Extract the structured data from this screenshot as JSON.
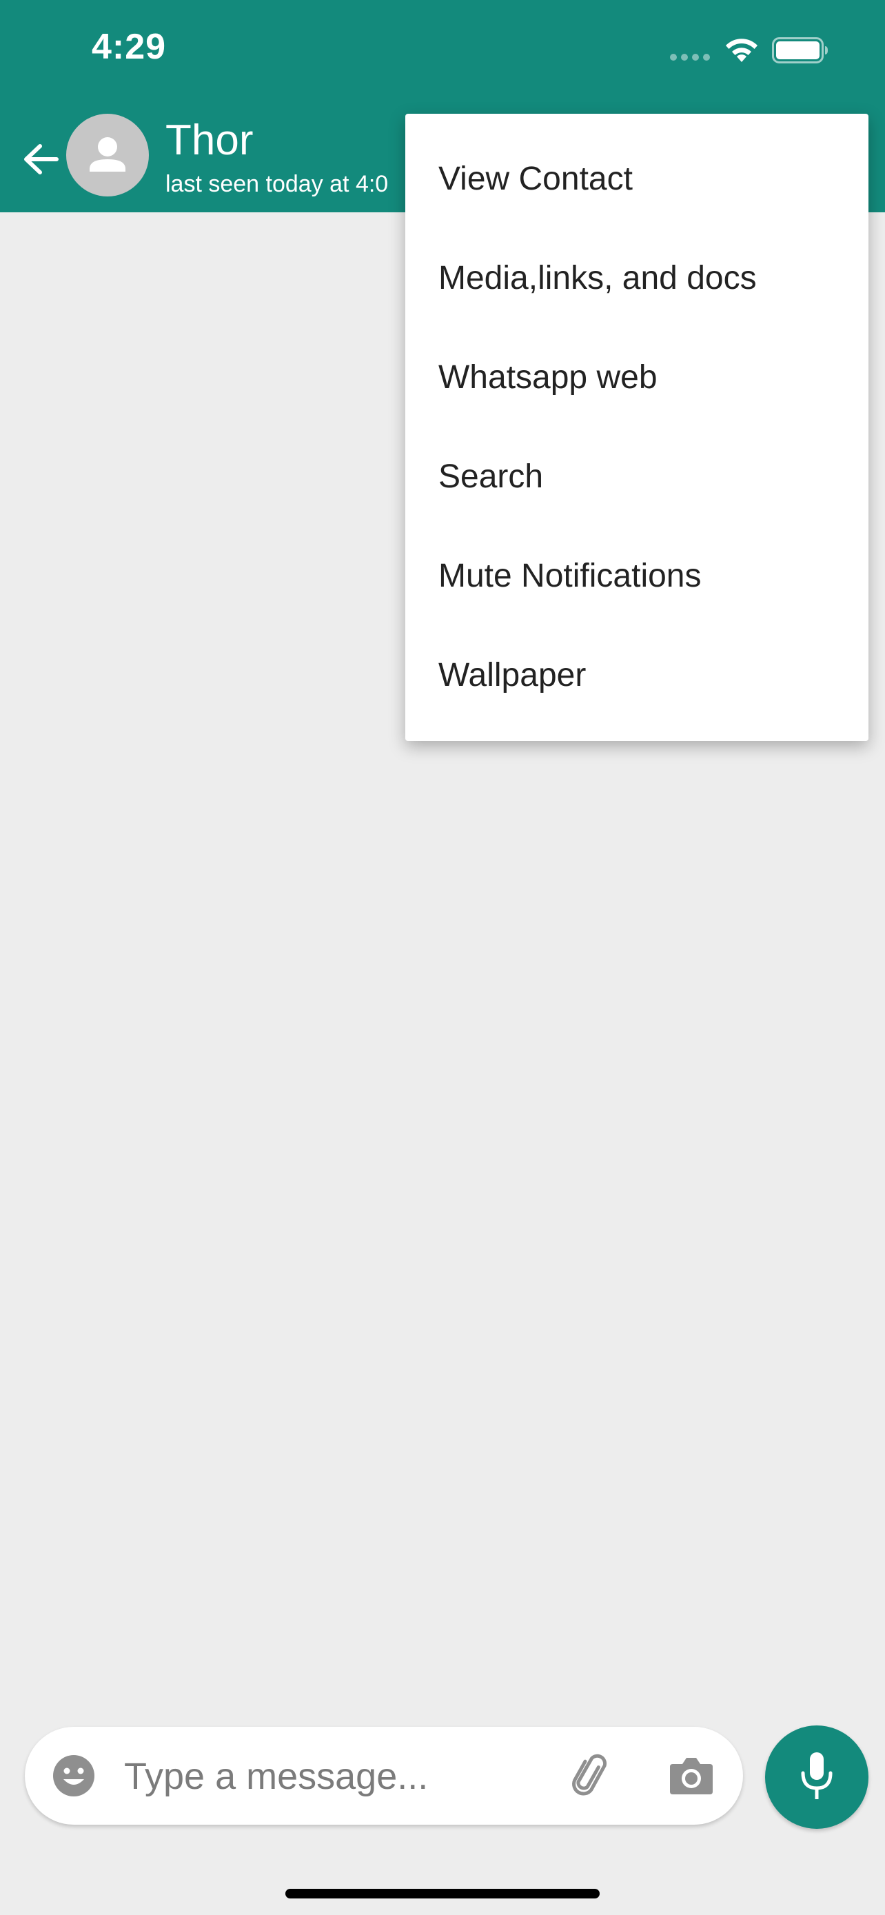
{
  "status_bar": {
    "time": "4:29"
  },
  "header": {
    "contact_name": "Thor",
    "last_seen": "last seen today at 4:0"
  },
  "menu": {
    "items": [
      {
        "label": "View Contact"
      },
      {
        "label": "Media,links, and docs"
      },
      {
        "label": "Whatsapp web"
      },
      {
        "label": "Search"
      },
      {
        "label": "Mute Notifications"
      },
      {
        "label": "Wallpaper"
      }
    ]
  },
  "composer": {
    "placeholder": "Type a message..."
  },
  "icons": {
    "back": "arrow-left-icon",
    "avatar": "person-icon",
    "emoji": "emoji-icon",
    "attach": "paperclip-icon",
    "camera": "camera-icon",
    "mic": "microphone-icon"
  },
  "colors": {
    "primary": "#138a7c",
    "background": "#ededed"
  }
}
